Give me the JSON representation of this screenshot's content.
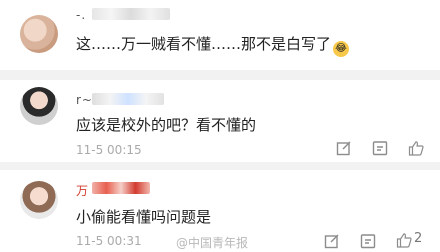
{
  "comments": [
    {
      "username": "-.",
      "text": "这……万一贼看不懂……那不是白写了",
      "emoji_name": "laughing-emoji"
    },
    {
      "username": "r~",
      "text": "应该是校外的吧？看不懂的",
      "time": "11-5 00:15"
    },
    {
      "username": "万",
      "text": "小偷能看懂吗问题是",
      "time": "11-5 00:31",
      "likes": "2"
    }
  ],
  "watermark": "@中国青年报",
  "icons": {
    "edit": "edit-icon",
    "share": "share-icon",
    "like": "thumbs-up-icon"
  }
}
